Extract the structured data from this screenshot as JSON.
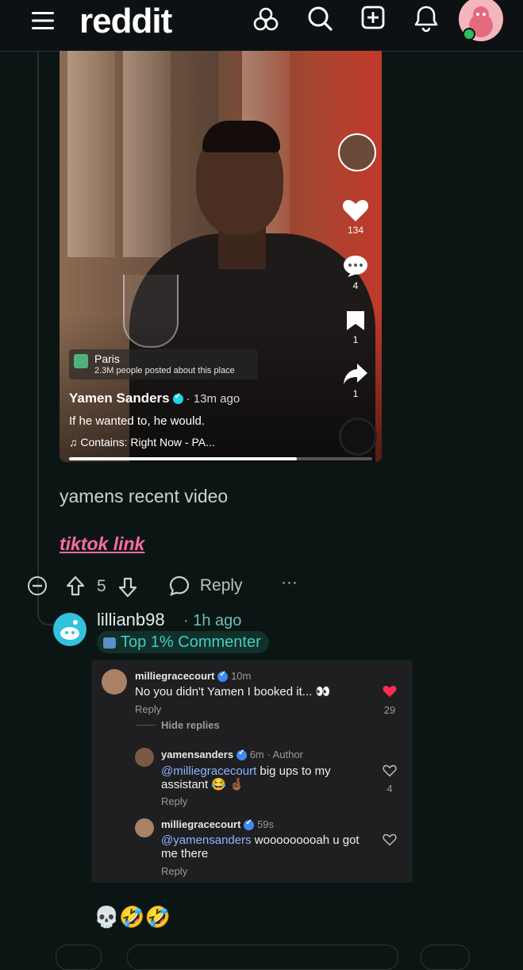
{
  "app": {
    "logo": "reddit"
  },
  "topbar": {
    "icons": [
      "menu-icon",
      "communities-icon",
      "search-icon",
      "create-post-icon",
      "notifications-icon",
      "user-avatar"
    ]
  },
  "video": {
    "location": {
      "name": "Paris",
      "sub": "2.3M people posted about this place"
    },
    "author": "Yamen Sanders",
    "time": "· 13m ago",
    "caption": "If he wanted to, he would.",
    "music": "Contains: Right Now - PA...",
    "likes": "134",
    "comments": "4",
    "saves": "1",
    "shares": "1",
    "progress": 0.75
  },
  "post": {
    "body": "yamens recent video",
    "link_text": "tiktok link",
    "vote_count": "5",
    "reply_label": "Reply",
    "more_label": "···"
  },
  "comment": {
    "username": "lillianb98",
    "time": "· 1h ago",
    "badge": "Top 1% Commenter",
    "emojis": "💀🤣🤣"
  },
  "tiktok_comments": {
    "top": {
      "user": "milliegracecourt",
      "time": "10m",
      "text": "No you didn't Yamen I booked it... 👀",
      "reply": "Reply",
      "likes": "29",
      "hide": "Hide replies"
    },
    "replies": [
      {
        "user": "yamensanders",
        "time": "6m · Author",
        "mention": "@milliegracecourt",
        "text_line1": " big ups to my",
        "text_line2": "assistant 😂 🤞🏾",
        "reply": "Reply",
        "likes": "4"
      },
      {
        "user": "milliegracecourt",
        "time": "59s",
        "mention": "@yamensanders",
        "text_line1": " wooooooooah u got",
        "text_line2": "me there",
        "reply": "Reply"
      }
    ]
  },
  "colors": {
    "background": "#0b1614",
    "link": "#ff6aa8",
    "badge": "#3fd0c4",
    "heart_liked": "#fe2c55"
  }
}
